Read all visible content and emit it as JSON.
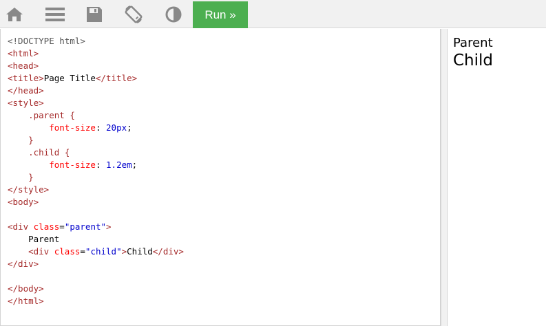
{
  "toolbar": {
    "icons": [
      {
        "name": "home-icon"
      },
      {
        "name": "menu-icon"
      },
      {
        "name": "save-icon"
      },
      {
        "name": "rotate-icon"
      },
      {
        "name": "theme-contrast-icon"
      }
    ],
    "run_label": "Run »",
    "run_color": "#4caf50"
  },
  "editor": {
    "lines": [
      [
        {
          "t": "doctype",
          "v": "<!DOCTYPE html>"
        }
      ],
      [
        {
          "t": "tag",
          "v": "<html>"
        }
      ],
      [
        {
          "t": "tag",
          "v": "<head>"
        }
      ],
      [
        {
          "t": "tag",
          "v": "<title>"
        },
        {
          "t": "text",
          "v": "Page Title"
        },
        {
          "t": "tag",
          "v": "</title>"
        }
      ],
      [
        {
          "t": "tag",
          "v": "</head>"
        }
      ],
      [
        {
          "t": "tag",
          "v": "<style>"
        }
      ],
      [
        {
          "t": "text",
          "v": "    "
        },
        {
          "t": "sel",
          "v": ".parent {"
        }
      ],
      [
        {
          "t": "text",
          "v": "        "
        },
        {
          "t": "prop",
          "v": "font-size"
        },
        {
          "t": "text",
          "v": ": "
        },
        {
          "t": "val",
          "v": "20px"
        },
        {
          "t": "text",
          "v": ";"
        }
      ],
      [
        {
          "t": "text",
          "v": "    "
        },
        {
          "t": "sel",
          "v": "}"
        }
      ],
      [
        {
          "t": "text",
          "v": "    "
        },
        {
          "t": "sel",
          "v": ".child {"
        }
      ],
      [
        {
          "t": "text",
          "v": "        "
        },
        {
          "t": "prop",
          "v": "font-size"
        },
        {
          "t": "text",
          "v": ": "
        },
        {
          "t": "val",
          "v": "1.2em"
        },
        {
          "t": "text",
          "v": ";"
        }
      ],
      [
        {
          "t": "text",
          "v": "    "
        },
        {
          "t": "sel",
          "v": "}"
        }
      ],
      [
        {
          "t": "tag",
          "v": "</style>"
        }
      ],
      [
        {
          "t": "tag",
          "v": "<body>"
        }
      ],
      [],
      [
        {
          "t": "tag",
          "v": "<div "
        },
        {
          "t": "attr",
          "v": "class"
        },
        {
          "t": "text",
          "v": "="
        },
        {
          "t": "attrval",
          "v": "\"parent\""
        },
        {
          "t": "tag",
          "v": ">"
        }
      ],
      [
        {
          "t": "text",
          "v": "    Parent"
        }
      ],
      [
        {
          "t": "text",
          "v": "    "
        },
        {
          "t": "tag",
          "v": "<div "
        },
        {
          "t": "attr",
          "v": "class"
        },
        {
          "t": "text",
          "v": "="
        },
        {
          "t": "attrval",
          "v": "\"child\""
        },
        {
          "t": "tag",
          "v": ">"
        },
        {
          "t": "text",
          "v": "Child"
        },
        {
          "t": "tag",
          "v": "</div>"
        }
      ],
      [
        {
          "t": "tag",
          "v": "</div>"
        }
      ],
      [],
      [
        {
          "t": "tag",
          "v": "</body>"
        }
      ],
      [
        {
          "t": "tag",
          "v": "</html>"
        }
      ]
    ]
  },
  "preview": {
    "parent_text": "Parent",
    "child_text": "Child"
  }
}
